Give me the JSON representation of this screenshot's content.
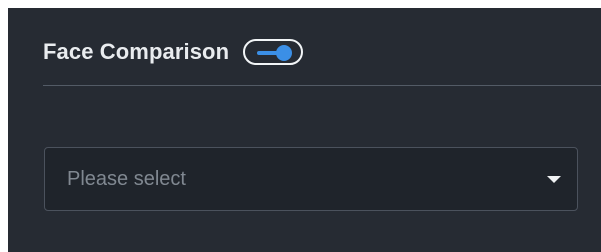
{
  "section": {
    "title": "Face Comparison",
    "toggle": {
      "state": "on",
      "accent_color": "#3b8fe6"
    }
  },
  "select": {
    "placeholder": "Please select",
    "icon": "chevron-down-icon"
  },
  "colors": {
    "panel_bg": "#262b33",
    "field_bg": "#1f242b",
    "border": "#4b525d",
    "text": "#e9ecef",
    "placeholder": "#808891"
  }
}
